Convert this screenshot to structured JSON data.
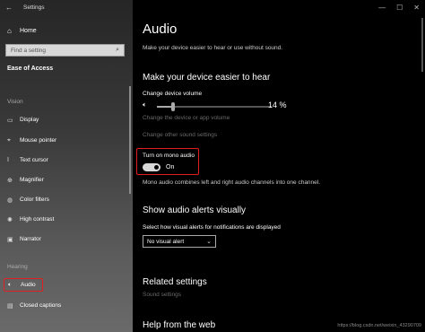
{
  "window": {
    "title": "Settings",
    "controls": [
      "—",
      "☐",
      "✕"
    ]
  },
  "sidebar": {
    "home_label": "Home",
    "search_placeholder": "Find a setting",
    "section_title": "Ease of Access",
    "groups": [
      {
        "label": "Vision",
        "items": [
          {
            "label": "Display",
            "icon": "display-icon"
          },
          {
            "label": "Mouse pointer",
            "icon": "mouse-pointer-icon"
          },
          {
            "label": "Text cursor",
            "icon": "text-cursor-icon"
          },
          {
            "label": "Magnifier",
            "icon": "magnifier-icon"
          },
          {
            "label": "Color filters",
            "icon": "color-filters-icon"
          },
          {
            "label": "High contrast",
            "icon": "high-contrast-icon"
          },
          {
            "label": "Narrator",
            "icon": "narrator-icon"
          }
        ]
      },
      {
        "label": "Hearing",
        "items": [
          {
            "label": "Audio",
            "icon": "speaker-icon",
            "selected": true
          },
          {
            "label": "Closed captions",
            "icon": "closed-captions-icon"
          }
        ]
      }
    ]
  },
  "main": {
    "title": "Audio",
    "subtitle": "Make your device easier to hear or use without sound.",
    "section1": {
      "heading": "Make your device easier to hear",
      "volume_label": "Change device volume",
      "volume_value": "14 %",
      "volume_level": 0.14,
      "link1": "Change the device or app volume",
      "link2": "Change other sound settings",
      "mono_label": "Turn on mono audio",
      "mono_state": "On",
      "mono_on": true,
      "mono_desc": "Mono audio combines left and right audio channels into one channel."
    },
    "section2": {
      "heading": "Show audio alerts visually",
      "select_label": "Select how visual alerts for notifications are displayed",
      "select_value": "No visual alert"
    },
    "related": {
      "heading": "Related settings",
      "link": "Sound settings"
    },
    "help": {
      "heading": "Help from the web"
    }
  },
  "watermark": "https://blog.csdn.net/weixin_43290709"
}
